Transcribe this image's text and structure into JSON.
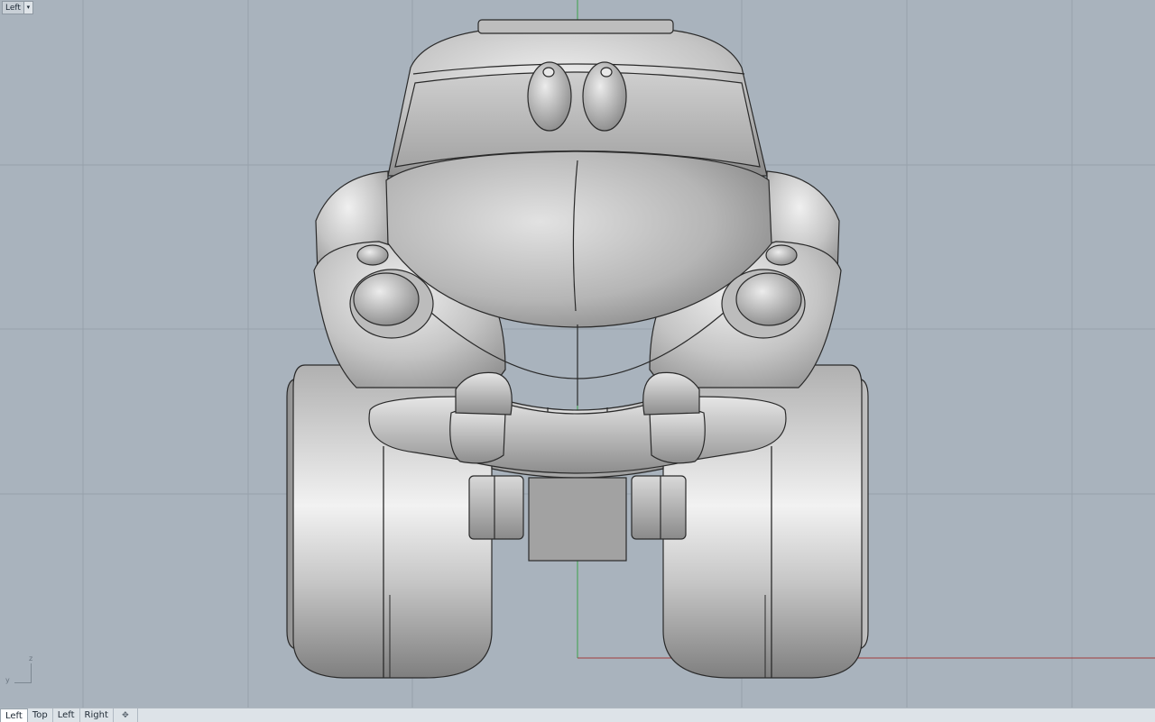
{
  "viewport": {
    "name": "Left",
    "dropdown_glyph": "▾"
  },
  "axes": {
    "z_label": "z",
    "y_label": "y"
  },
  "tabs": [
    {
      "label": "Left",
      "active": true
    },
    {
      "label": "Top",
      "active": false
    },
    {
      "label": "Left",
      "active": false
    },
    {
      "label": "Right",
      "active": false
    }
  ],
  "add_tab_glyph": "✥",
  "colors": {
    "background": "#a9b3bd",
    "grid_minor": "#9aa5af",
    "grid_major": "#8f9aa5",
    "x_axis": "#a0383a",
    "y_axis": "#2f9b3e",
    "model_shade": "#c8c8c8"
  }
}
